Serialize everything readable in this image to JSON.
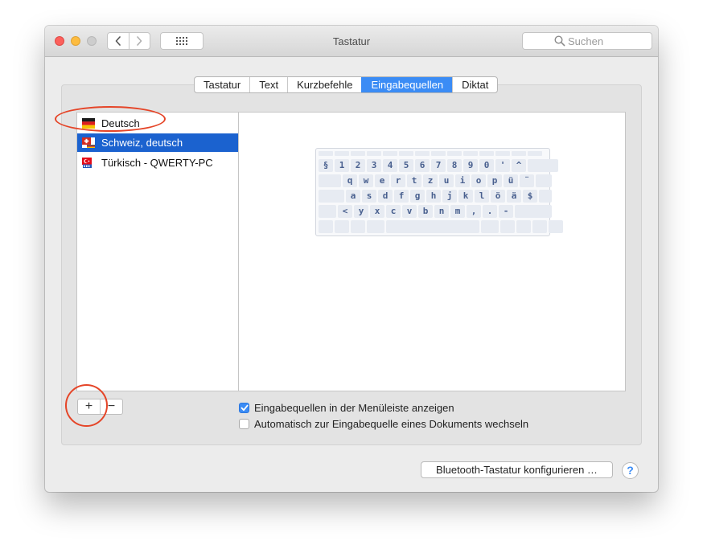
{
  "window": {
    "title": "Tastatur"
  },
  "toolbar": {
    "back_icon": "chevron-left-icon",
    "forward_icon": "chevron-right-icon",
    "grid_icon": "grid-icon",
    "search_placeholder": "Suchen",
    "search_value": ""
  },
  "tabs": [
    {
      "label": "Tastatur",
      "active": false
    },
    {
      "label": "Text",
      "active": false
    },
    {
      "label": "Kurzbefehle",
      "active": false
    },
    {
      "label": "Eingabequellen",
      "active": true
    },
    {
      "label": "Diktat",
      "active": false
    }
  ],
  "sources": [
    {
      "label": "Deutsch",
      "flag": "flag-germany-icon",
      "selected": false
    },
    {
      "label": "Schweiz, deutsch",
      "flag": "flag-switzerland-icon",
      "selected": true
    },
    {
      "label": "Türkisch - QWERTY-PC",
      "flag": "flag-turkey-icon",
      "selected": false
    }
  ],
  "keyboard": {
    "row1": [
      "§",
      "1",
      "2",
      "3",
      "4",
      "5",
      "6",
      "7",
      "8",
      "9",
      "0",
      "'",
      "^"
    ],
    "row2": [
      "q",
      "w",
      "e",
      "r",
      "t",
      "z",
      "u",
      "i",
      "o",
      "p",
      "ü",
      "¨"
    ],
    "row3": [
      "a",
      "s",
      "d",
      "f",
      "g",
      "h",
      "j",
      "k",
      "l",
      "ö",
      "ä",
      "$"
    ],
    "row4": [
      "<",
      "y",
      "x",
      "c",
      "v",
      "b",
      "n",
      "m",
      ",",
      ".",
      "-"
    ]
  },
  "list_buttons": {
    "add": "+",
    "remove": "−"
  },
  "checkboxes": [
    {
      "label": "Eingabequellen in der Menüleiste anzeigen",
      "checked": true
    },
    {
      "label": "Automatisch zur Eingabequelle eines Dokuments wechseln",
      "checked": false
    }
  ],
  "bluetooth_button": "Bluetooth-Tastatur konfigurieren …",
  "help_button": "?",
  "colors": {
    "accent": "#3b8cf5",
    "selection": "#1b62cf",
    "annotation": "#e54528"
  }
}
